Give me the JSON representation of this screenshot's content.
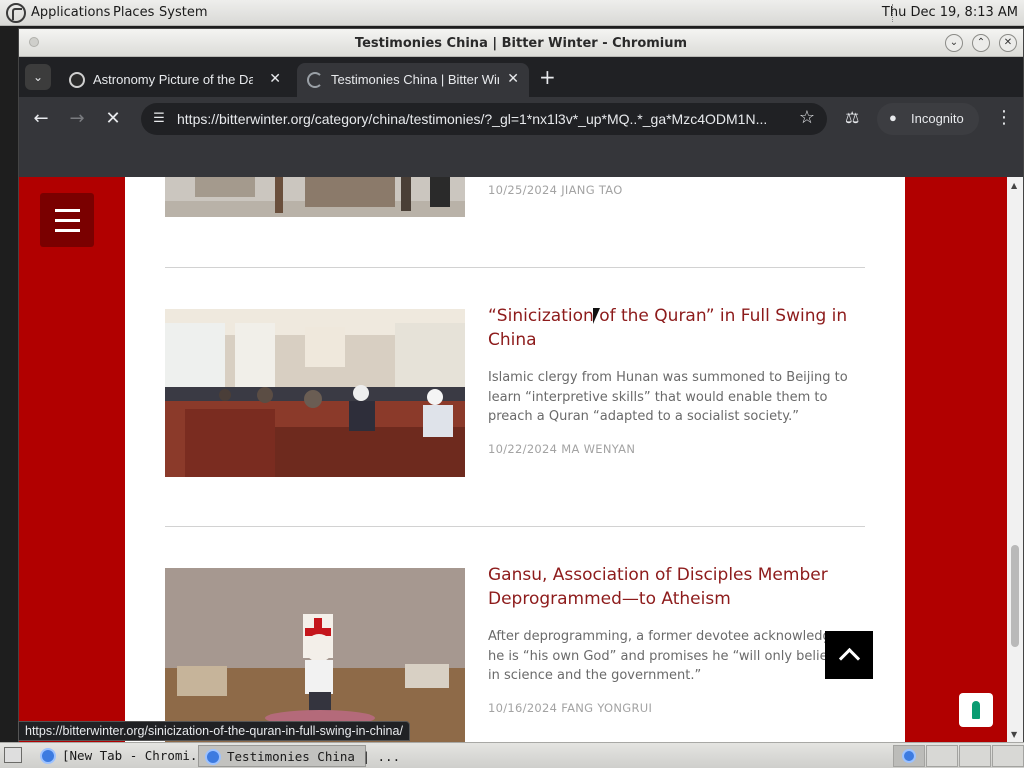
{
  "top_panel": {
    "menus": [
      "Applications",
      "Places",
      "System"
    ],
    "clock": "Thu Dec 19,  8:13 AM"
  },
  "window": {
    "title": "Testimonies China | Bitter Winter - Chromium",
    "tabs": [
      {
        "label": "Astronomy Picture of the Day",
        "active": false
      },
      {
        "label": "Testimonies China | Bitter Winter",
        "active": true
      }
    ],
    "url": "https://bitterwinter.org/category/china/testimonies/?_gl=1*nx1l3v*_up*MQ..*_ga*Mzc4ODM1N...",
    "incognito_label": "Incognito"
  },
  "page": {
    "articles": [
      {
        "title": "",
        "excerpt": "",
        "meta": "10/25/2024 JIANG TAO"
      },
      {
        "title": "“Sinicization of the Quran” in Full Swing in China",
        "excerpt": "Islamic clergy from Hunan was summoned to Beijing to learn “interpretive skills” that would enable them to preach a Quran “adapted to a socialist society.”",
        "meta": "10/22/2024 MA WENYAN"
      },
      {
        "title": "Gansu, Association of Disciples Member Deprogrammed—to Atheism",
        "excerpt": "After deprogramming, a former devotee acknowledges he is “his own God” and promises he “will only believe in science and the government.”",
        "meta": "10/16/2024 FANG YONGRUI"
      }
    ]
  },
  "status_url": "https://bitterwinter.org/sinicization-of-the-quran-in-full-swing-in-china/",
  "taskbar": {
    "tasks": [
      "[New Tab - Chromi...",
      "Testimonies China | ..."
    ]
  },
  "colors": {
    "brand_red": "#b10000",
    "title_red": "#8d1b1b"
  }
}
